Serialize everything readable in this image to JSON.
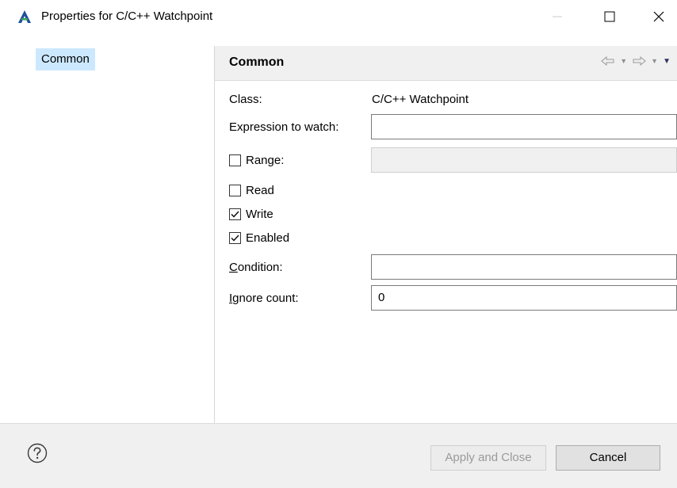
{
  "window": {
    "title": "Properties for C/C++ Watchpoint",
    "controls": {
      "minimize_icon": "minimize-icon",
      "maximize_icon": "maximize-icon",
      "close_icon": "close-icon"
    }
  },
  "tree": {
    "items": [
      {
        "label": "Common",
        "selected": true
      }
    ]
  },
  "page": {
    "title": "Common",
    "nav_icons": [
      "back-arrow-icon",
      "forward-arrow-icon",
      "view-menu-icon"
    ]
  },
  "form": {
    "class_label": "Class:",
    "class_value": "C/C++ Watchpoint",
    "expression_label": "Expression to watch:",
    "expression_value": "",
    "range_label": "Range:",
    "range_checked": false,
    "range_value": "",
    "read_label": "Read",
    "read_checked": false,
    "write_label": "Write",
    "write_checked": true,
    "enabled_label": "Enabled",
    "enabled_checked": true,
    "condition_mnemonic": "C",
    "condition_label_rest": "ondition:",
    "condition_value": "",
    "ignore_mnemonic": "I",
    "ignore_label_rest": "gnore count:",
    "ignore_value": "0"
  },
  "footer": {
    "help_icon": "help-icon",
    "apply_label": "Apply and Close",
    "apply_enabled": false,
    "cancel_label": "Cancel"
  },
  "colors": {
    "selection": "#cce8ff",
    "header_bg": "#f0f0f0",
    "disabled_text": "#9a9a9a"
  }
}
